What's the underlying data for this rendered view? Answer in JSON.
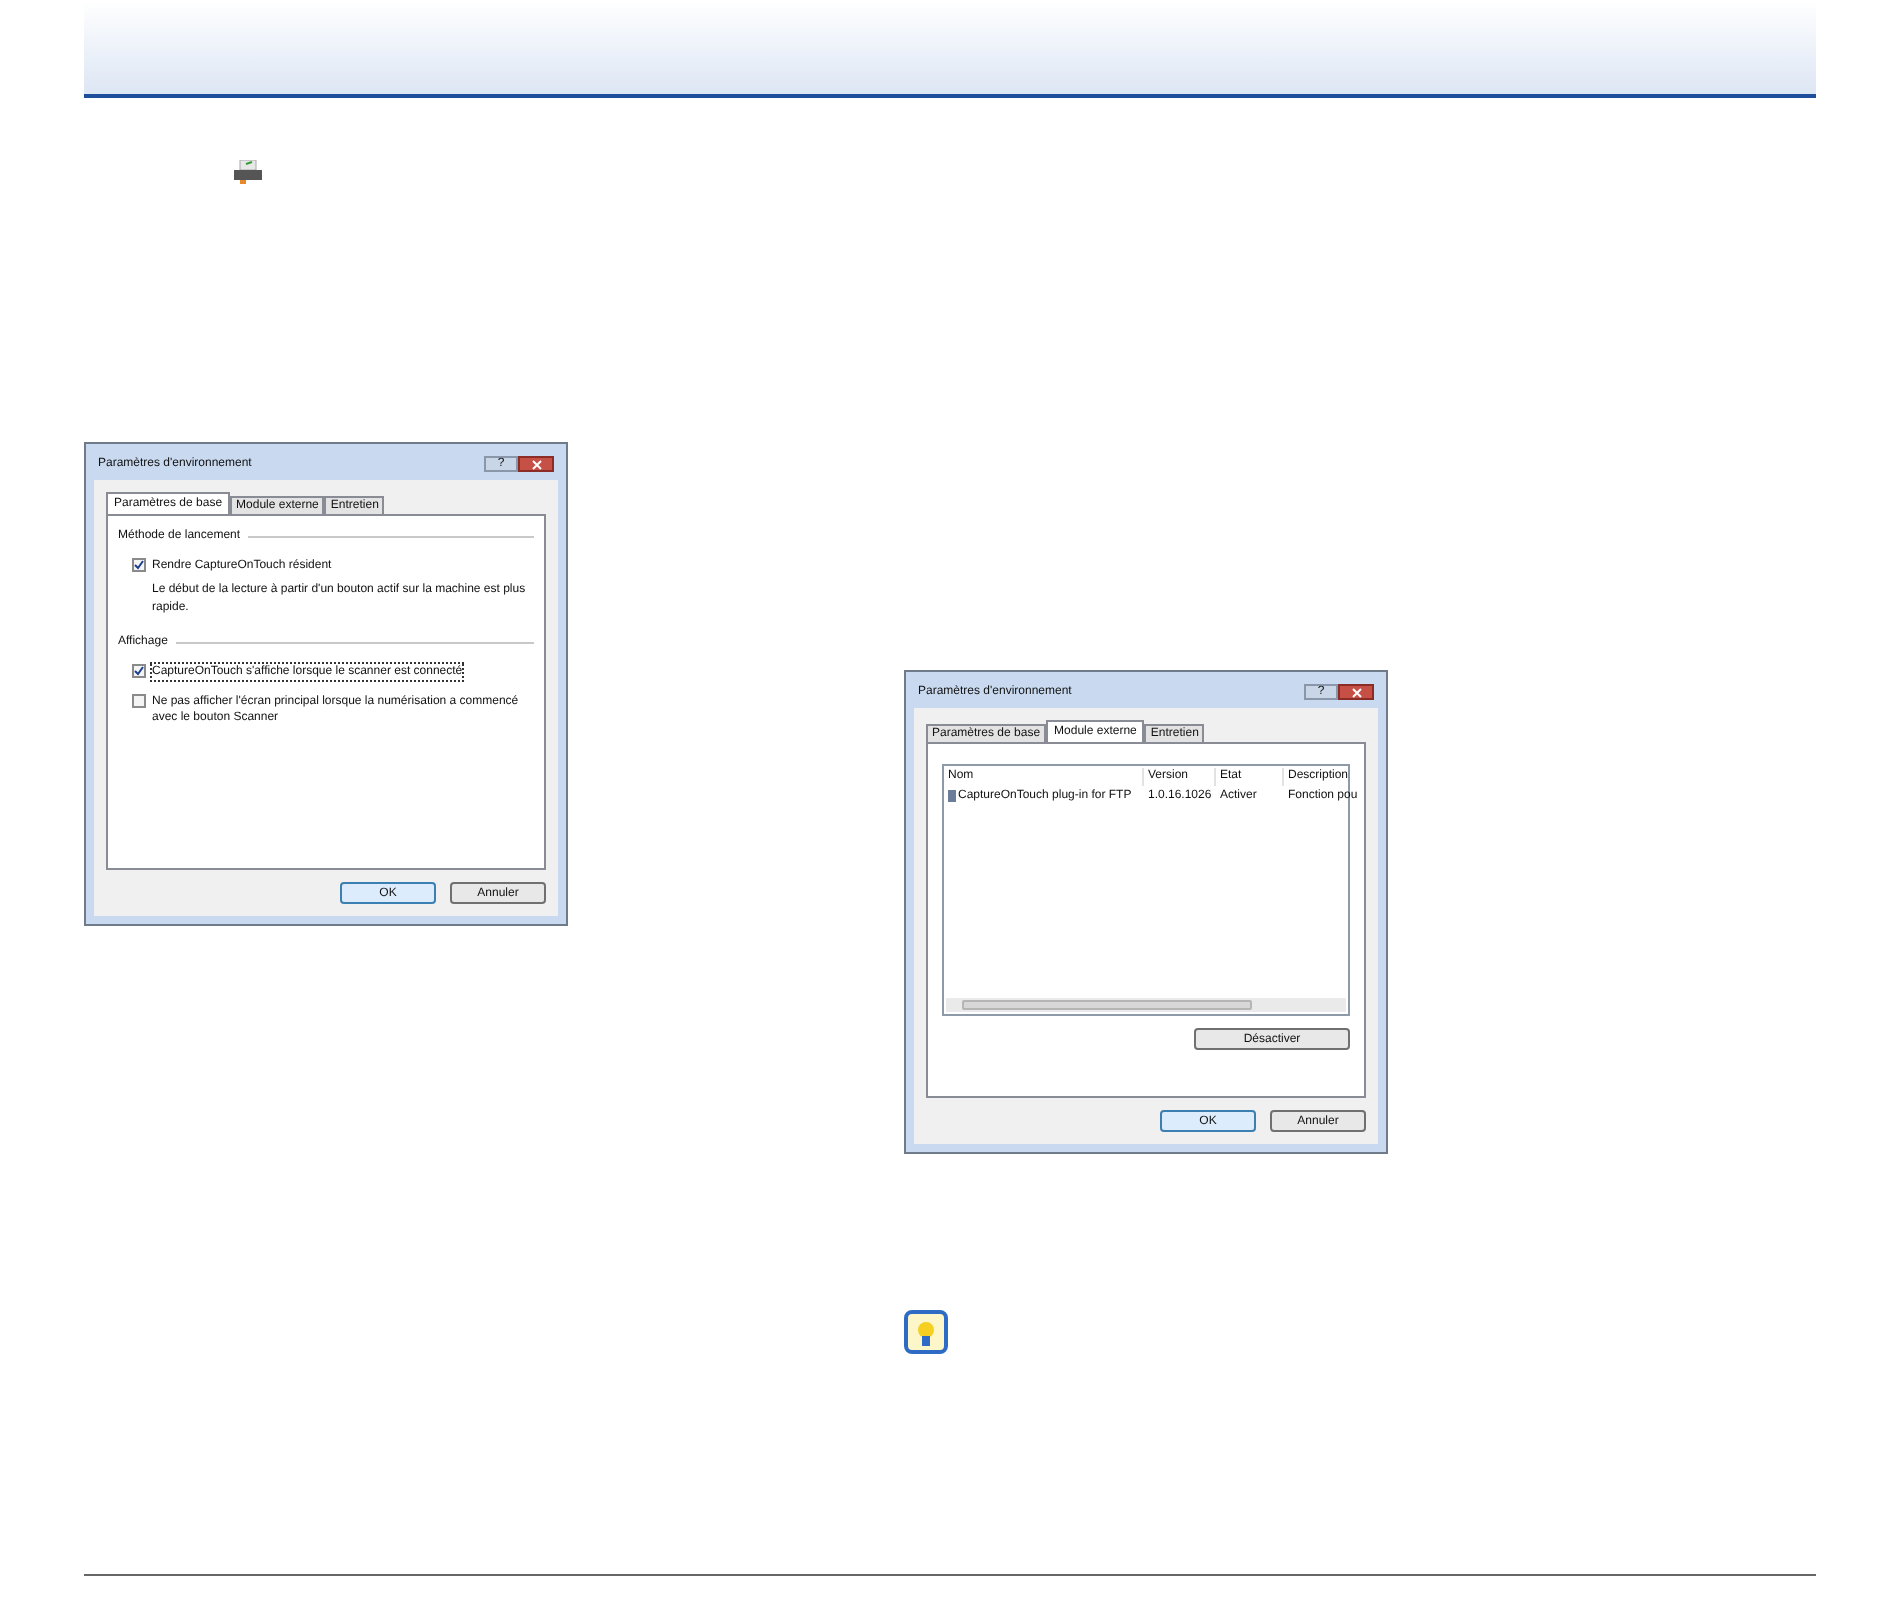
{
  "dialogs": [
    {
      "title": "Paramètres d'environnement",
      "help": "?",
      "tabs": [
        {
          "label": "Paramètres de base",
          "selected": true
        },
        {
          "label": "Module externe",
          "selected": false
        },
        {
          "label": "Entretien",
          "selected": false
        }
      ],
      "panel": {
        "kind": "general",
        "sections": [
          {
            "heading": "Méthode de lancement",
            "items": [
              {
                "label": "Rendre CaptureOnTouch résident",
                "checked": true,
                "focused": false,
                "note": "Le début de la lecture à partir d'un bouton actif sur la machine est plus rapide."
              }
            ]
          },
          {
            "heading": "Affichage",
            "items": [
              {
                "label": "CaptureOnTouch s'affiche lorsque le scanner est connecté",
                "checked": true,
                "focused": true
              },
              {
                "label": "Ne pas afficher l'écran principal lorsque la numérisation a commencé avec le bouton Scanner",
                "checked": false,
                "focused": false
              }
            ]
          }
        ]
      },
      "buttons": [
        {
          "label": "OK",
          "default": true
        },
        {
          "label": "Annuler",
          "default": false
        }
      ]
    },
    {
      "title": "Paramètres d'environnement",
      "help": "?",
      "tabs": [
        {
          "label": "Paramètres de base",
          "selected": false
        },
        {
          "label": "Module externe",
          "selected": true
        },
        {
          "label": "Entretien",
          "selected": false
        }
      ],
      "panel": {
        "kind": "plugins",
        "columns": [
          "Nom",
          "Version",
          "Etat",
          "Description"
        ],
        "rows": [
          {
            "cells": [
              "CaptureOnTouch plug-in for FTP",
              "1.0.16.1026",
              "Activer",
              "Fonction pou"
            ]
          }
        ],
        "action": "Désactiver"
      },
      "buttons": [
        {
          "label": "OK",
          "default": true
        },
        {
          "label": "Annuler",
          "default": false
        }
      ]
    }
  ]
}
